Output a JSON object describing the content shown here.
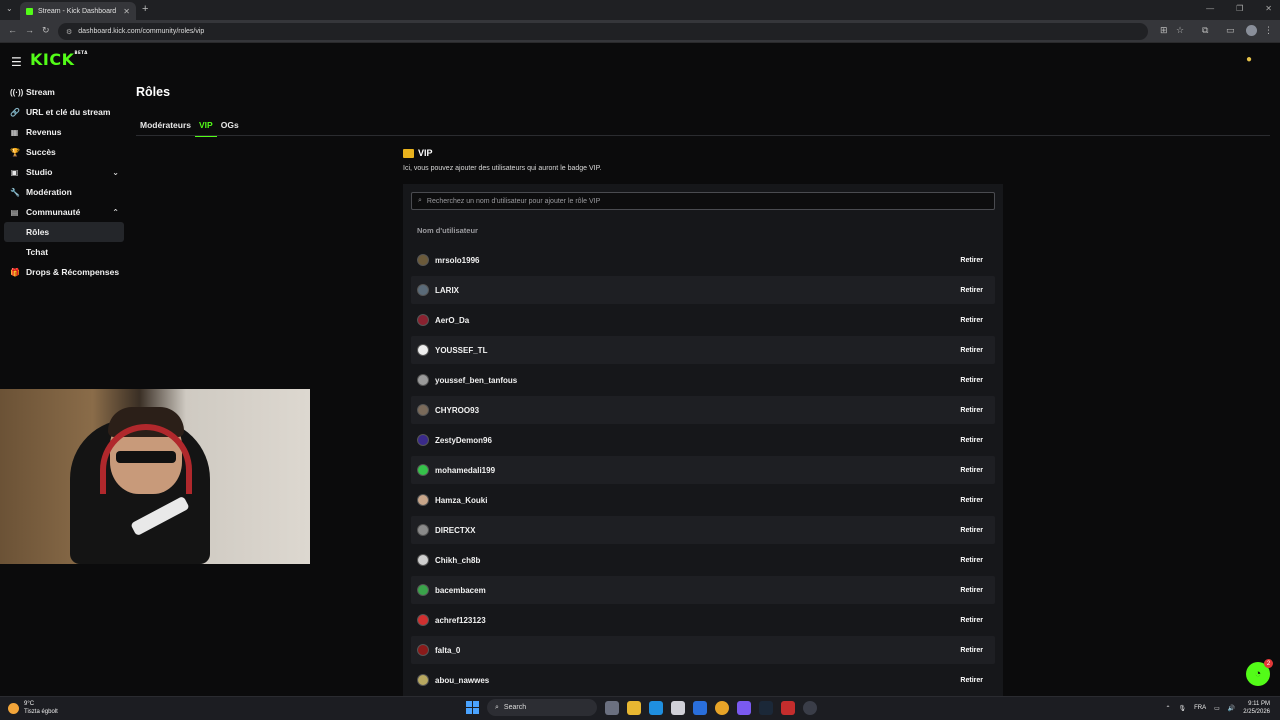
{
  "browser": {
    "tab_title": "Stream - Kick Dashboard",
    "url": "dashboard.kick.com/community/roles/vip"
  },
  "app": {
    "logo": "KICK",
    "logo_beta": "BETA"
  },
  "sidebar": {
    "items": [
      {
        "label": "Stream",
        "icon": "broadcast-icon"
      },
      {
        "label": "URL et clé du stream",
        "icon": "link-icon"
      },
      {
        "label": "Revenus",
        "icon": "revenue-icon"
      },
      {
        "label": "Succès",
        "icon": "trophy-icon"
      },
      {
        "label": "Studio",
        "icon": "studio-icon"
      },
      {
        "label": "Modération",
        "icon": "wrench-icon"
      },
      {
        "label": "Communauté",
        "icon": "community-icon"
      },
      {
        "label": "Rôles"
      },
      {
        "label": "Tchat"
      },
      {
        "label": "Drops & Récompenses",
        "icon": "gift-icon"
      }
    ]
  },
  "main": {
    "title": "Rôles",
    "tabs": [
      {
        "label": "Modérateurs"
      },
      {
        "label": "VIP"
      },
      {
        "label": "OGs"
      }
    ],
    "vip": {
      "heading": "VIP",
      "description": "Ici, vous pouvez ajouter des utilisateurs qui auront le badge VIP.",
      "search_placeholder": "Recherchez un nom d'utilisateur pour ajouter le rôle VIP",
      "column_header": "Nom d'utilisateur",
      "remove_label": "Retirer",
      "users": [
        {
          "name": "mrsolo1996",
          "color": "#6b5a3a"
        },
        {
          "name": "LARIX",
          "color": "#5a6a78"
        },
        {
          "name": "AerO_Da",
          "color": "#8a2230"
        },
        {
          "name": "YOUSSEF_TL",
          "color": "#eeeeee"
        },
        {
          "name": "youssef_ben_tanfous",
          "color": "#9a9a9a"
        },
        {
          "name": "CHYROO93",
          "color": "#7a6a5a"
        },
        {
          "name": "ZestyDemon96",
          "color": "#3a2a8a"
        },
        {
          "name": "mohamedali199",
          "color": "#35c24a"
        },
        {
          "name": "Hamza_Kouki",
          "color": "#c8a68a"
        },
        {
          "name": "DIRECTXX",
          "color": "#8a8a8a"
        },
        {
          "name": "Chikh_ch8b",
          "color": "#cfcfcf"
        },
        {
          "name": "bacembacem",
          "color": "#3aa34a"
        },
        {
          "name": "achref123123",
          "color": "#d03030"
        },
        {
          "name": "falta_0",
          "color": "#8a1a1a"
        },
        {
          "name": "abou_nawwes",
          "color": "#b8a860"
        }
      ]
    }
  },
  "help": {
    "badge": "2"
  },
  "taskbar": {
    "weather_temp": "9°C",
    "weather_desc": "Tiszta égbolt",
    "search_label": "Search",
    "lang": "FRA",
    "time": "9:11 PM",
    "date": "2/25/2026"
  },
  "colors": {
    "accent": "#53fc18",
    "background": "#0b0b0c",
    "panel": "#16171a"
  }
}
